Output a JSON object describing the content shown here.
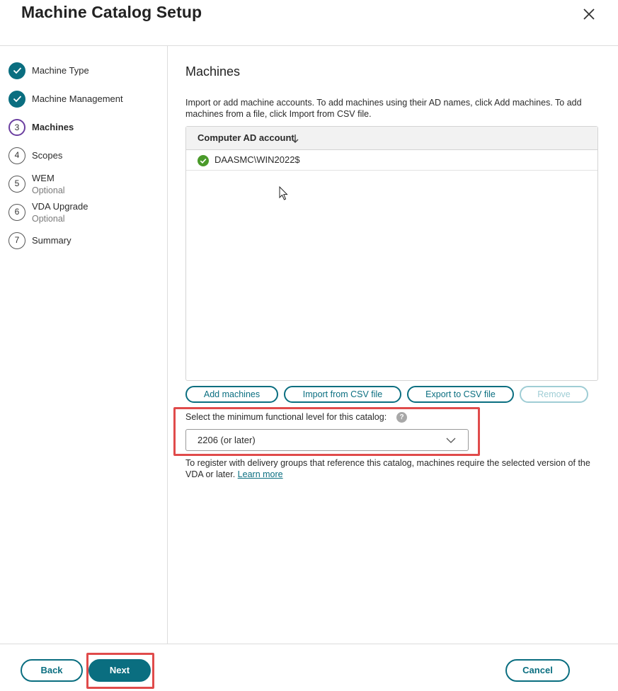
{
  "window": {
    "title": "Machine Catalog Setup",
    "close_icon": "close-icon"
  },
  "steps": [
    {
      "number": "1",
      "label": "Machine Type",
      "sub": "",
      "state": "done"
    },
    {
      "number": "2",
      "label": "Machine Management",
      "sub": "",
      "state": "done"
    },
    {
      "number": "3",
      "label": "Machines",
      "sub": "",
      "state": "current"
    },
    {
      "number": "4",
      "label": "Scopes",
      "sub": "",
      "state": "pending"
    },
    {
      "number": "5",
      "label": "WEM",
      "sub": "Optional",
      "state": "pending"
    },
    {
      "number": "6",
      "label": "VDA Upgrade",
      "sub": "Optional",
      "state": "pending"
    },
    {
      "number": "7",
      "label": "Summary",
      "sub": "",
      "state": "pending"
    }
  ],
  "main": {
    "title": "Machines",
    "intro": "Import or add machine accounts. To add machines using their AD names, click Add machines. To add machines from a file, click Import from CSV file.",
    "table": {
      "column_header": "Computer AD account",
      "rows": [
        {
          "account": "DAASMC\\WIN2022$",
          "status": "ok"
        }
      ]
    },
    "buttons": {
      "add": "Add machines",
      "import": "Import from CSV file",
      "export": "Export to CSV file",
      "remove": "Remove"
    },
    "functional_level": {
      "label": "Select the minimum functional level for this catalog:",
      "help": "?",
      "selected": "2206 (or later)"
    },
    "note": "To register with delivery groups that reference this catalog, machines require the selected version of the VDA or later.",
    "learn_more": "Learn more"
  },
  "footer": {
    "back": "Back",
    "next": "Next",
    "cancel": "Cancel"
  },
  "colors": {
    "accent": "#0a6e80",
    "current_step": "#6b3fa0",
    "success": "#4a9a2a",
    "highlight": "#e04b4b"
  }
}
